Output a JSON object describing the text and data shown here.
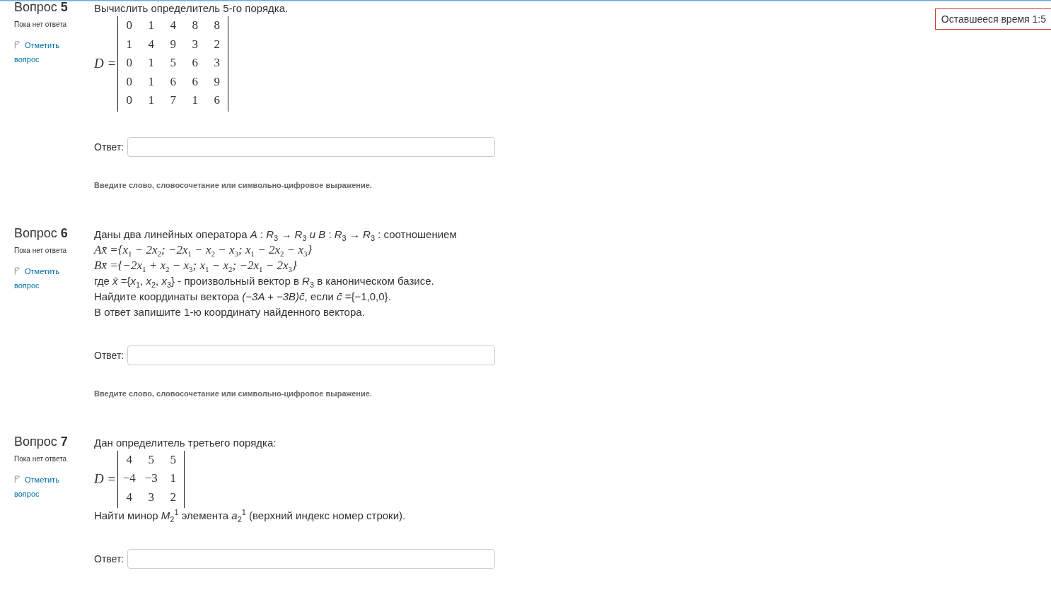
{
  "timer": {
    "text": "Оставшееся время 1:5"
  },
  "questions": [
    {
      "title": "Вопрос",
      "number": "5",
      "status": "Пока нет ответа",
      "flag_link": "Отметить вопрос",
      "content": [
        {
          "kind": "text",
          "text": "Вычислить определитель 5-го порядка."
        },
        {
          "kind": "determinant",
          "label": "D =",
          "rows": [
            [
              "0",
              "1",
              "4",
              "8",
              "8"
            ],
            [
              "1",
              "4",
              "9",
              "3",
              "2"
            ],
            [
              "0",
              "1",
              "5",
              "6",
              "3"
            ],
            [
              "0",
              "1",
              "6",
              "6",
              "9"
            ],
            [
              "0",
              "1",
              "7",
              "1",
              "6"
            ]
          ]
        }
      ],
      "answer_label": "Ответ:",
      "hint": "Введите слово, словосочетание или символьно-цифровое выражение."
    },
    {
      "title": "Вопрос",
      "number": "6",
      "status": "Пока нет ответа",
      "flag_link": "Отметить вопрос",
      "content": [
        {
          "kind": "text",
          "text": "Даны два линейных оператора *A* : *R*$_{3}$ → *R*$_{3}$ *и* *B* : *R*$_{3}$ → *R*$_{3}$ : соотношением"
        },
        {
          "kind": "math",
          "text": "Ax̄ ={x$_{1}$ − 2x$_{2}$; −2x$_{1}$ − x$_{2}$ − x$_{3}$; x$_{1}$ − 2x$_{2}$ − x$_{3}$}"
        },
        {
          "kind": "math",
          "text": "Bx̄ ={−2x$_{1}$ + x$_{2}$ − x$_{3}$; x$_{1}$ − x$_{2}$; −2x$_{1}$ − 2x$_{3}$}"
        },
        {
          "kind": "text",
          "text": "где *x̄* ={*x*$_{1}$, *x*$_{2}$, *x*$_{3}$} - произвольный вектор в *R*$_{3}$ в каноническом базисе."
        },
        {
          "kind": "text",
          "text": "Найдите координаты вектора *(−3A + −3B)c̄*, если *c̄* ={−1,0,0}."
        },
        {
          "kind": "text",
          "text": "В ответ запишите 1-ю координату найденного вектора."
        }
      ],
      "answer_label": "Ответ:",
      "hint": "Введите слово, словосочетание или символьно-цифровое выражение."
    },
    {
      "title": "Вопрос",
      "number": "7",
      "status": "Пока нет ответа",
      "flag_link": "Отметить вопрос",
      "content": [
        {
          "kind": "text",
          "text": "Дан определитель третьего порядка:"
        },
        {
          "kind": "determinant",
          "label": "D =",
          "rows": [
            [
              "4",
              "5",
              "5"
            ],
            [
              "−4",
              "−3",
              "1"
            ],
            [
              "4",
              "3",
              "2"
            ]
          ]
        },
        {
          "kind": "text",
          "text": "Найти минор *M*$_{2}$$^{1}$ элемента *a*$_{2}$$^{1}$ (верхний индекс номер строки)."
        }
      ],
      "answer_label": "Ответ:"
    }
  ]
}
